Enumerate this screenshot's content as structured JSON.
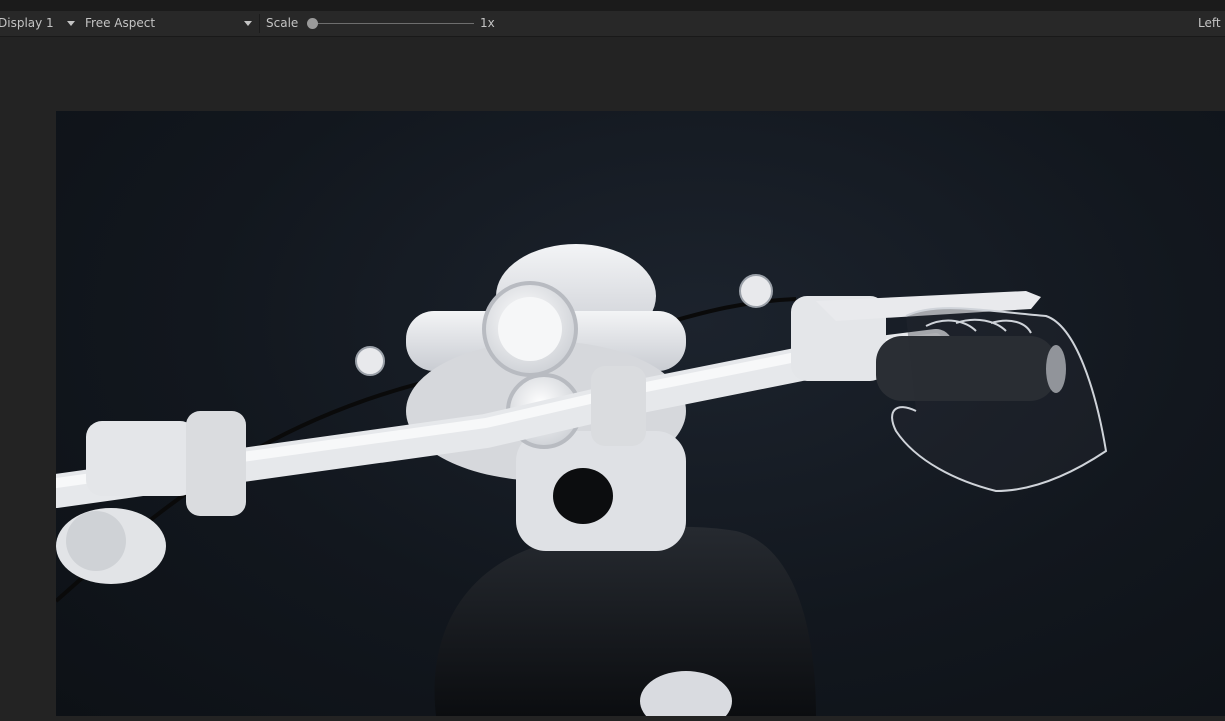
{
  "toolbar": {
    "display": "Display 1",
    "aspect": "Free Aspect",
    "scale_label": "Scale",
    "scale_value": "1x",
    "scale_slider_fraction": 0.0,
    "right_label": "Left"
  },
  "viewport": {
    "scene": "motorcycle-handlebar-3d-view"
  },
  "colors": {
    "editor_bg": "#232323",
    "toolbar_bg": "#282828",
    "scene_bg": "#12171e",
    "model_white": "#e8e9ec"
  }
}
